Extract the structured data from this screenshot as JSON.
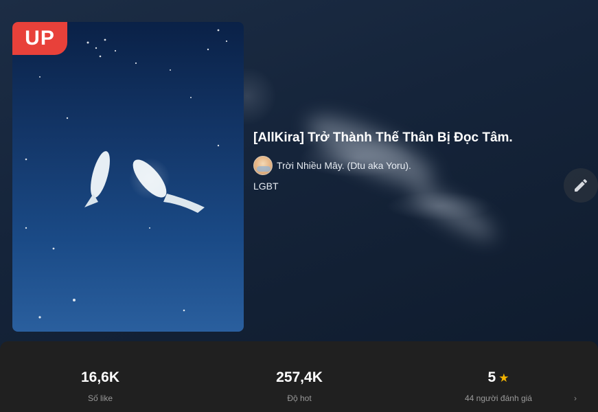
{
  "badge": {
    "label": "UP"
  },
  "story": {
    "title": "[AllKira] Trở Thành Thế Thân Bị Đọc Tâm.",
    "author": "Trời Nhiều Mây. (Dtu aka Yoru).",
    "genre": "LGBT"
  },
  "icons": {
    "edit": "pencil-icon",
    "rating": "star-icon",
    "more": "chevron-right-icon"
  },
  "stats": [
    {
      "value": "16,6K",
      "label": "Số like"
    },
    {
      "value": "257,4K",
      "label": "Độ hot"
    },
    {
      "value": "5",
      "label": "44 người đánh giá"
    }
  ],
  "colors": {
    "badge": "#e8413a",
    "star": "#f4b400",
    "panel": "#202020"
  }
}
